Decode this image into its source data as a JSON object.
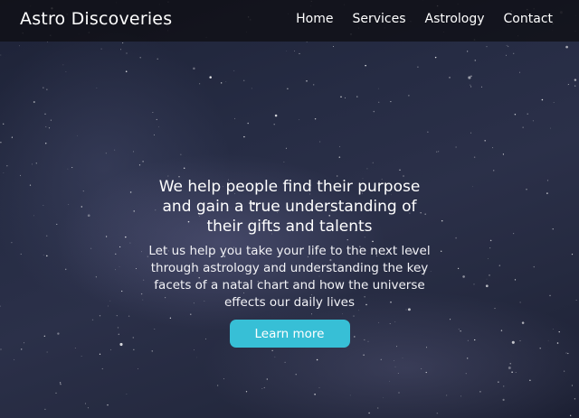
{
  "nav": {
    "brand": "Astro Discoveries",
    "links": [
      {
        "label": "Home"
      },
      {
        "label": "Services"
      },
      {
        "label": "Astrology"
      },
      {
        "label": "Contact"
      }
    ]
  },
  "hero": {
    "headline": "We help people find their purpose and gain a true understanding of their gifts and talents",
    "subtext": "Let us help you take your life to the next level through astrology and understanding the key facets of a natal chart and how the universe effects our daily lives",
    "cta_label": "Learn more"
  },
  "colors": {
    "accent": "#37bfd6",
    "navbar": "#101016",
    "sky": "#262c44"
  }
}
